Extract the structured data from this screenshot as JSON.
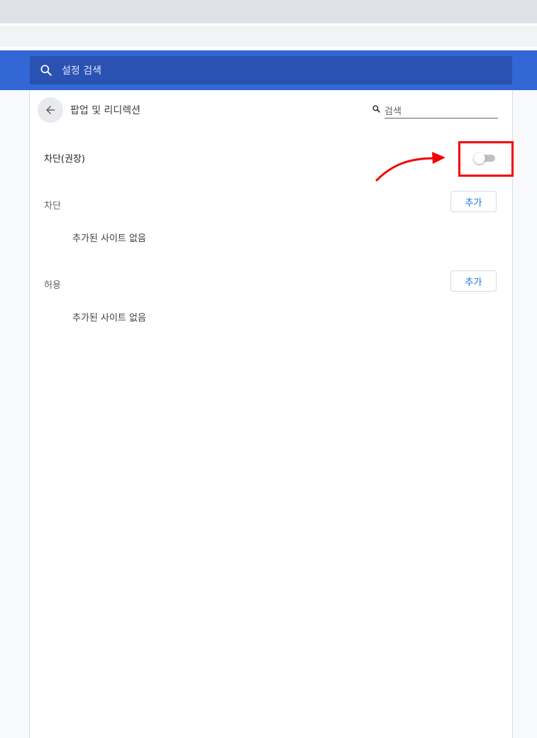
{
  "header": {
    "search_placeholder": "설정 검색"
  },
  "subpage": {
    "title": "팝업 및 리디렉션",
    "search_placeholder": "검색"
  },
  "toggle_row": {
    "label": "차단(권장)",
    "enabled": false
  },
  "sections": [
    {
      "label": "차단",
      "add_label": "추가",
      "empty_text": "추가된 사이트 없음"
    },
    {
      "label": "허용",
      "add_label": "추가",
      "empty_text": "추가된 사이트 없음"
    }
  ],
  "icons": {
    "search": "search-icon",
    "back": "arrow-back-icon"
  },
  "colors": {
    "header_bg": "#3367d6",
    "search_bg": "#2a52b3",
    "accent": "#1a73e8",
    "annotation": "#f50000"
  }
}
